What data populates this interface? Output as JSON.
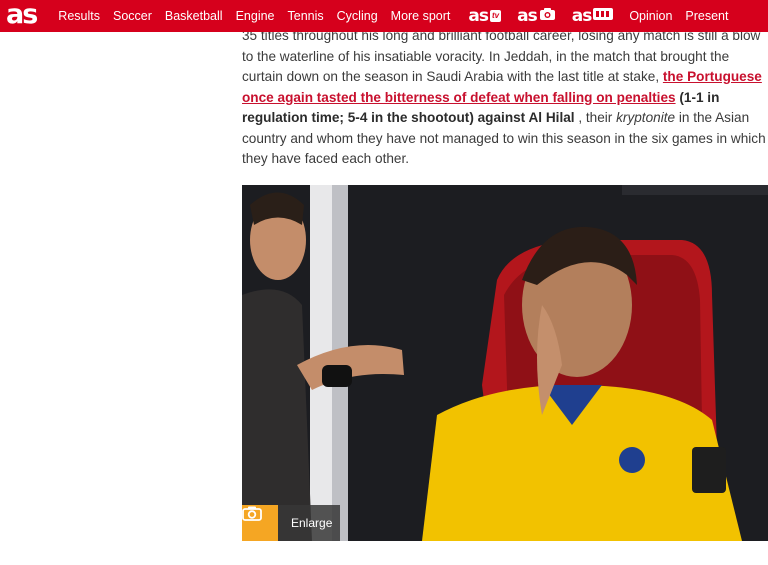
{
  "site": {
    "logo": "as"
  },
  "nav": {
    "items": [
      "Results",
      "Soccer",
      "Basketball",
      "Engine",
      "Tennis",
      "Cycling",
      "More sport"
    ],
    "brand_links": [
      {
        "word": "as",
        "tag": "tv"
      },
      {
        "word": "as",
        "tag": "camera"
      },
      {
        "word": "as",
        "tag": "color"
      }
    ],
    "items_right": [
      "Opinion",
      "Present"
    ]
  },
  "article": {
    "intro": "35 titles throughout his long and brilliant football career, losing any match is still a blow to the waterline of his insatiable voracity. In Jeddah, in the match that brought the curtain down on the season in Saudi Arabia with the last title at stake,",
    "link_text": "the Portuguese once again tasted the bitterness of defeat when falling on penalties",
    "bold_text": "(1-1 in regulation time; 5-4 in the shootout) against Al Hilal",
    "mid": " , their ",
    "italic_text": "kryptonite",
    "outro": " in the Asian country and whom they have not managed to win this season in the six games in which they have faced each other."
  },
  "photo": {
    "enlarge_label": "Enlarge",
    "icon": "camera-icon"
  },
  "colors": {
    "brand_red": "#d6001c",
    "link_red": "#c8102e",
    "enlarge_orange": "#f5a623"
  }
}
